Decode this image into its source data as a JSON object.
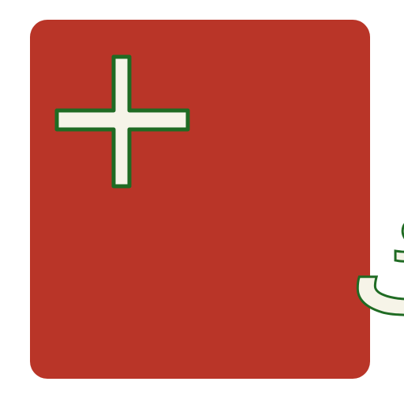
{
  "icon": {
    "background_color": "#b93528",
    "glyph_fill_color": "#f6f4e8",
    "glyph_outline_color": "#1f6b23",
    "plus_symbol": "plus-icon",
    "arabic_text": "باك"
  }
}
